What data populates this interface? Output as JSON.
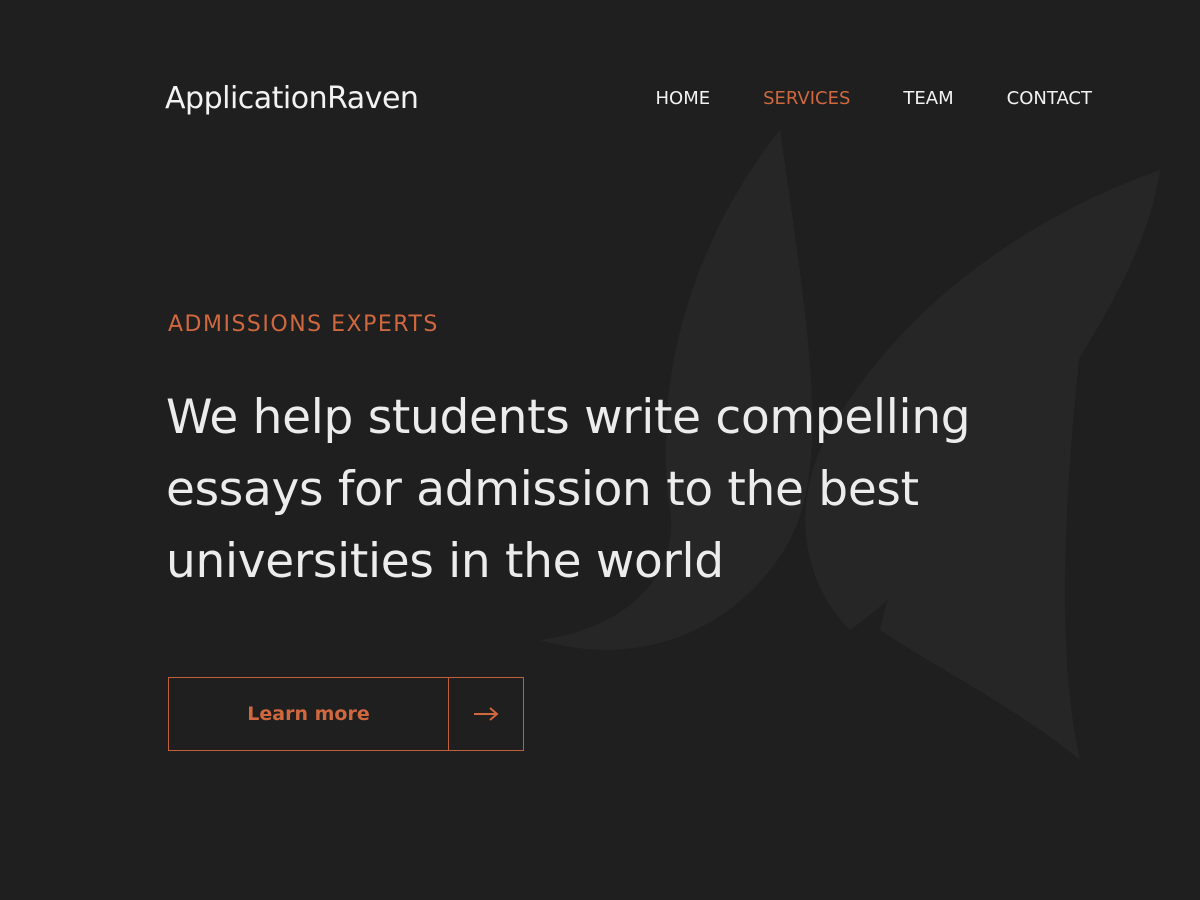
{
  "header": {
    "logo_text": "ApplicationRaven",
    "nav": [
      {
        "label": "HOME",
        "active": false
      },
      {
        "label": "SERVICES",
        "active": true
      },
      {
        "label": "TEAM",
        "active": false
      },
      {
        "label": "CONTACT",
        "active": false
      }
    ]
  },
  "hero": {
    "eyebrow": "ADMISSIONS EXPERTS",
    "headline_lines": [
      "We help students write compelling",
      "essays for admission to the best",
      "universities in the world"
    ],
    "cta_label": "Learn more",
    "cta_icon": "arrow-right-icon",
    "background_icon": "raven-wing-icon"
  },
  "colors": {
    "background": "#1f1f1f",
    "accent": "#d0683f",
    "text": "#ececec"
  }
}
